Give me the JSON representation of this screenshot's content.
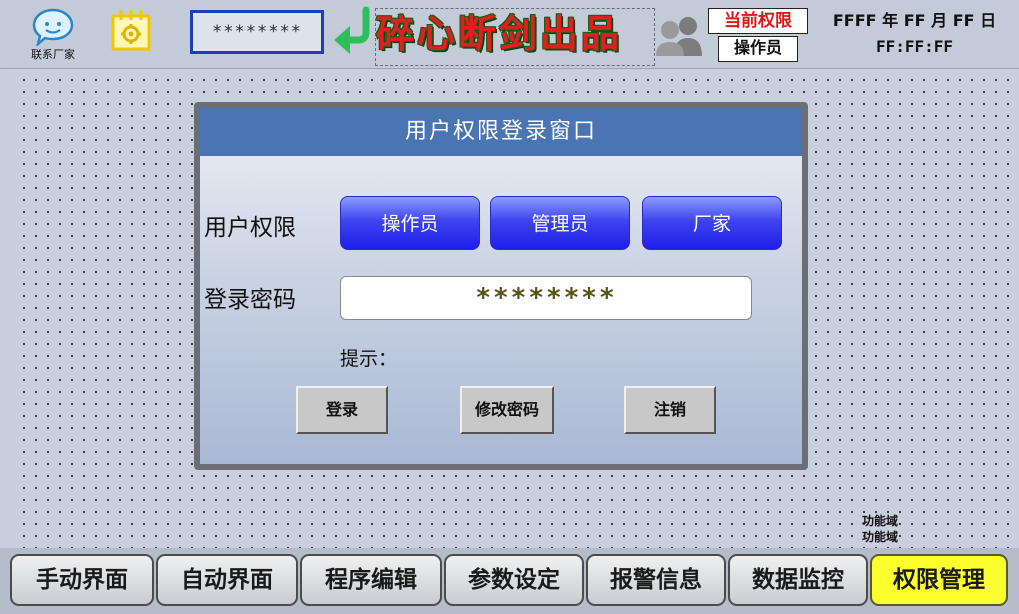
{
  "header": {
    "contact_label": "联系厂家",
    "password_display": "********",
    "brand_text": "碎心断剑出品",
    "permission_title": "当前权限",
    "permission_value": "操作员",
    "date": "FFFF 年 FF 月 FF 日",
    "time": "FF:FF:FF"
  },
  "dialog": {
    "title": "用户权限登录窗口",
    "role_label": "用户权限",
    "roles": [
      "操作员",
      "管理员",
      "厂家"
    ],
    "password_label": "登录密码",
    "password_value": "********",
    "hint_label": "提示：",
    "buttons": {
      "login": "登录",
      "change_password": "修改密码",
      "logout": "注销"
    }
  },
  "function_area_labels": [
    "功能域",
    "功能域"
  ],
  "nav": {
    "tabs": [
      "手动界面",
      "自动界面",
      "程序编辑",
      "参数设定",
      "报警信息",
      "数据监控",
      "权限管理"
    ],
    "active_tab": "权限管理"
  },
  "colors": {
    "active_tab": "#fbff2b",
    "dialog_title_bg": "#4a74b2",
    "role_button": "#1e1eea",
    "brand_text": "#e02020",
    "permission_title_text": "#e01818"
  },
  "icons": {
    "contact": "chat-bubble-icon",
    "gear": "gear-icon",
    "back": "return-arrow-icon",
    "users": "users-icon"
  }
}
